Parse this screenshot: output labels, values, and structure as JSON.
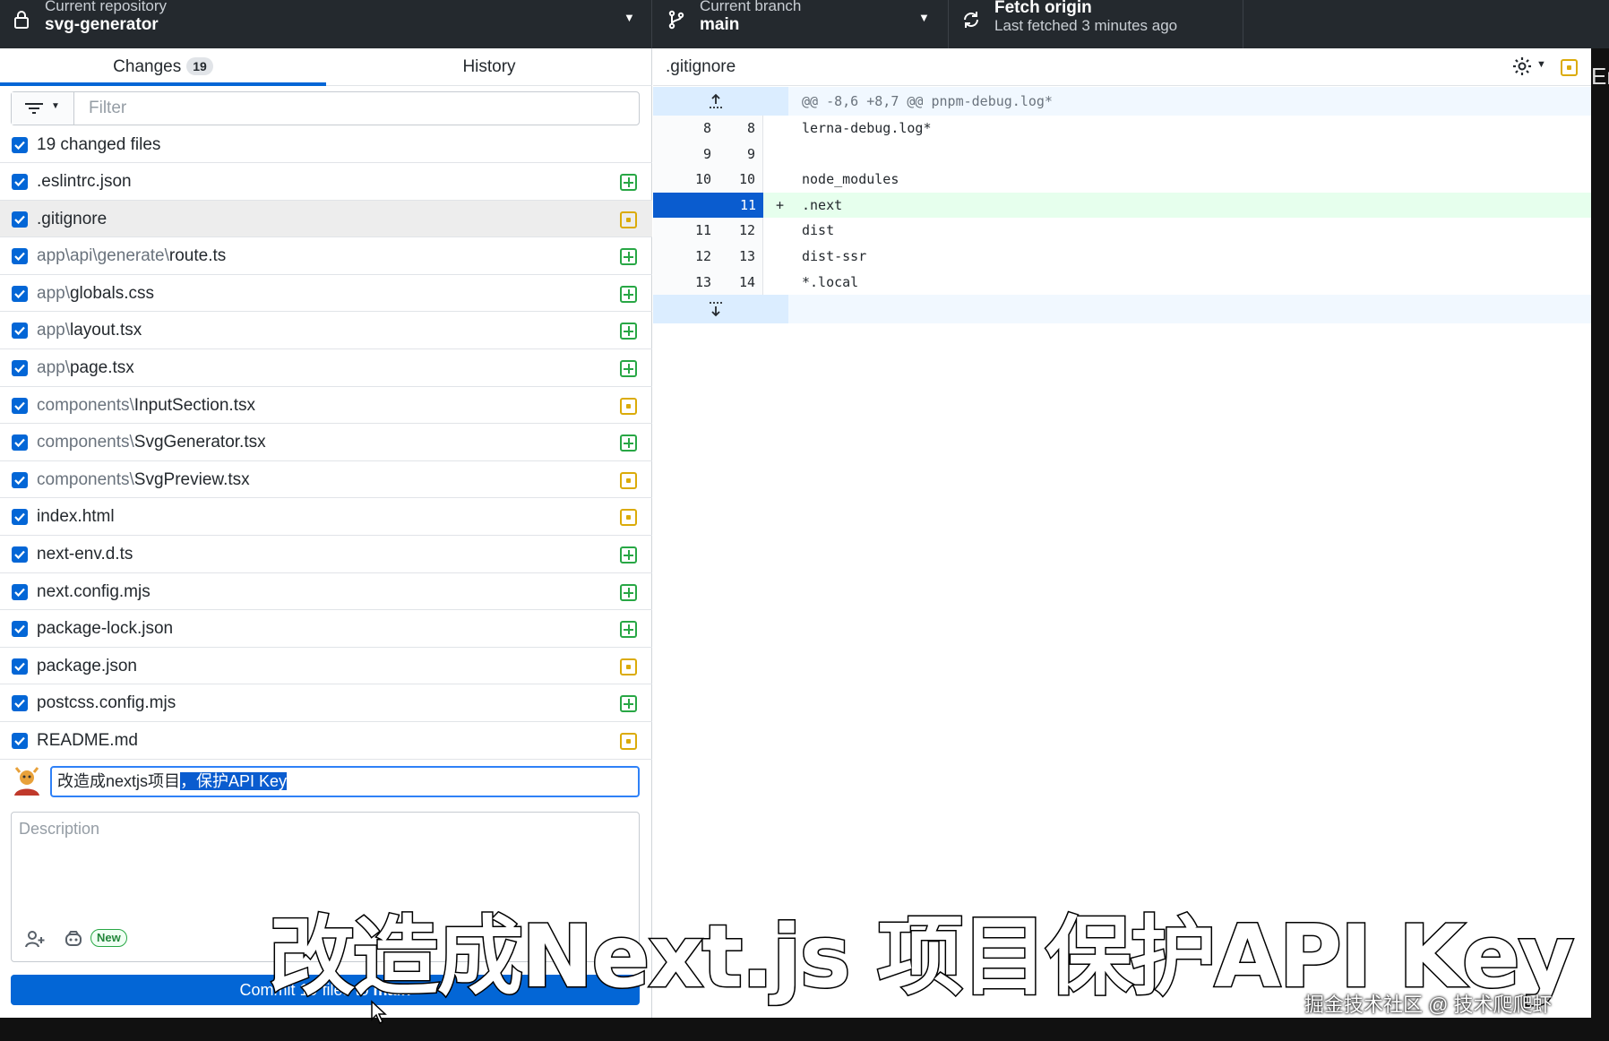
{
  "topbar": {
    "repo_label": "Current repository",
    "repo_name": "svg-generator",
    "branch_label": "Current branch",
    "branch_name": "main",
    "fetch_title": "Fetch origin",
    "fetch_subtitle": "Last fetched 3 minutes ago"
  },
  "tabs": {
    "changes_label": "Changes",
    "changes_count": "19",
    "history_label": "History"
  },
  "filter": {
    "placeholder": "Filter"
  },
  "changed_files_label": "19 changed files",
  "files": [
    {
      "dir": "",
      "name": ".eslintrc.json",
      "status": "added",
      "checked": true
    },
    {
      "dir": "",
      "name": ".gitignore",
      "status": "modified",
      "checked": true,
      "selected": true
    },
    {
      "dir": "app\\api\\generate\\",
      "name": "route.ts",
      "status": "added",
      "checked": true
    },
    {
      "dir": "app\\",
      "name": "globals.css",
      "status": "added",
      "checked": true
    },
    {
      "dir": "app\\",
      "name": "layout.tsx",
      "status": "added",
      "checked": true
    },
    {
      "dir": "app\\",
      "name": "page.tsx",
      "status": "added",
      "checked": true
    },
    {
      "dir": "components\\",
      "name": "InputSection.tsx",
      "status": "modified",
      "checked": true
    },
    {
      "dir": "components\\",
      "name": "SvgGenerator.tsx",
      "status": "added",
      "checked": true
    },
    {
      "dir": "components\\",
      "name": "SvgPreview.tsx",
      "status": "modified",
      "checked": true
    },
    {
      "dir": "",
      "name": "index.html",
      "status": "modified",
      "checked": true
    },
    {
      "dir": "",
      "name": "next-env.d.ts",
      "status": "added",
      "checked": true
    },
    {
      "dir": "",
      "name": "next.config.mjs",
      "status": "added",
      "checked": true
    },
    {
      "dir": "",
      "name": "package-lock.json",
      "status": "added",
      "checked": true
    },
    {
      "dir": "",
      "name": "package.json",
      "status": "modified",
      "checked": true
    },
    {
      "dir": "",
      "name": "postcss.config.mjs",
      "status": "added",
      "checked": true
    },
    {
      "dir": "",
      "name": "README.md",
      "status": "modified",
      "checked": true
    }
  ],
  "commit": {
    "summary_plain": "改造成nextjs项目",
    "summary_selected": "，保护API Key",
    "description_placeholder": "Description",
    "new_badge": "New",
    "button_prefix": "Commit 19 files to ",
    "button_branch": "main"
  },
  "diff": {
    "file": ".gitignore",
    "hunk_header": "@@ -8,6 +8,7 @@ pnpm-debug.log*",
    "lines": [
      {
        "type": "ctx",
        "old": "8",
        "new": "8",
        "marker": "",
        "text": "lerna-debug.log*"
      },
      {
        "type": "ctx",
        "old": "9",
        "new": "9",
        "marker": "",
        "text": ""
      },
      {
        "type": "ctx",
        "old": "10",
        "new": "10",
        "marker": "",
        "text": "node_modules"
      },
      {
        "type": "add",
        "old": "",
        "new": "11",
        "marker": "+",
        "text": ".next"
      },
      {
        "type": "ctx",
        "old": "11",
        "new": "12",
        "marker": "",
        "text": "dist"
      },
      {
        "type": "ctx",
        "old": "12",
        "new": "13",
        "marker": "",
        "text": "dist-ssr"
      },
      {
        "type": "ctx",
        "old": "13",
        "new": "14",
        "marker": "",
        "text": "*.local"
      }
    ]
  },
  "overlay": {
    "caption": "改造成Next.js 项目保护API Key",
    "watermark": "掘金技术社区 @ 技术爬爬虾",
    "edge_text": "En"
  },
  "colors": {
    "accent": "#0366d6",
    "added": "#28a745",
    "modified": "#dbab09",
    "topbar": "#24292e"
  }
}
